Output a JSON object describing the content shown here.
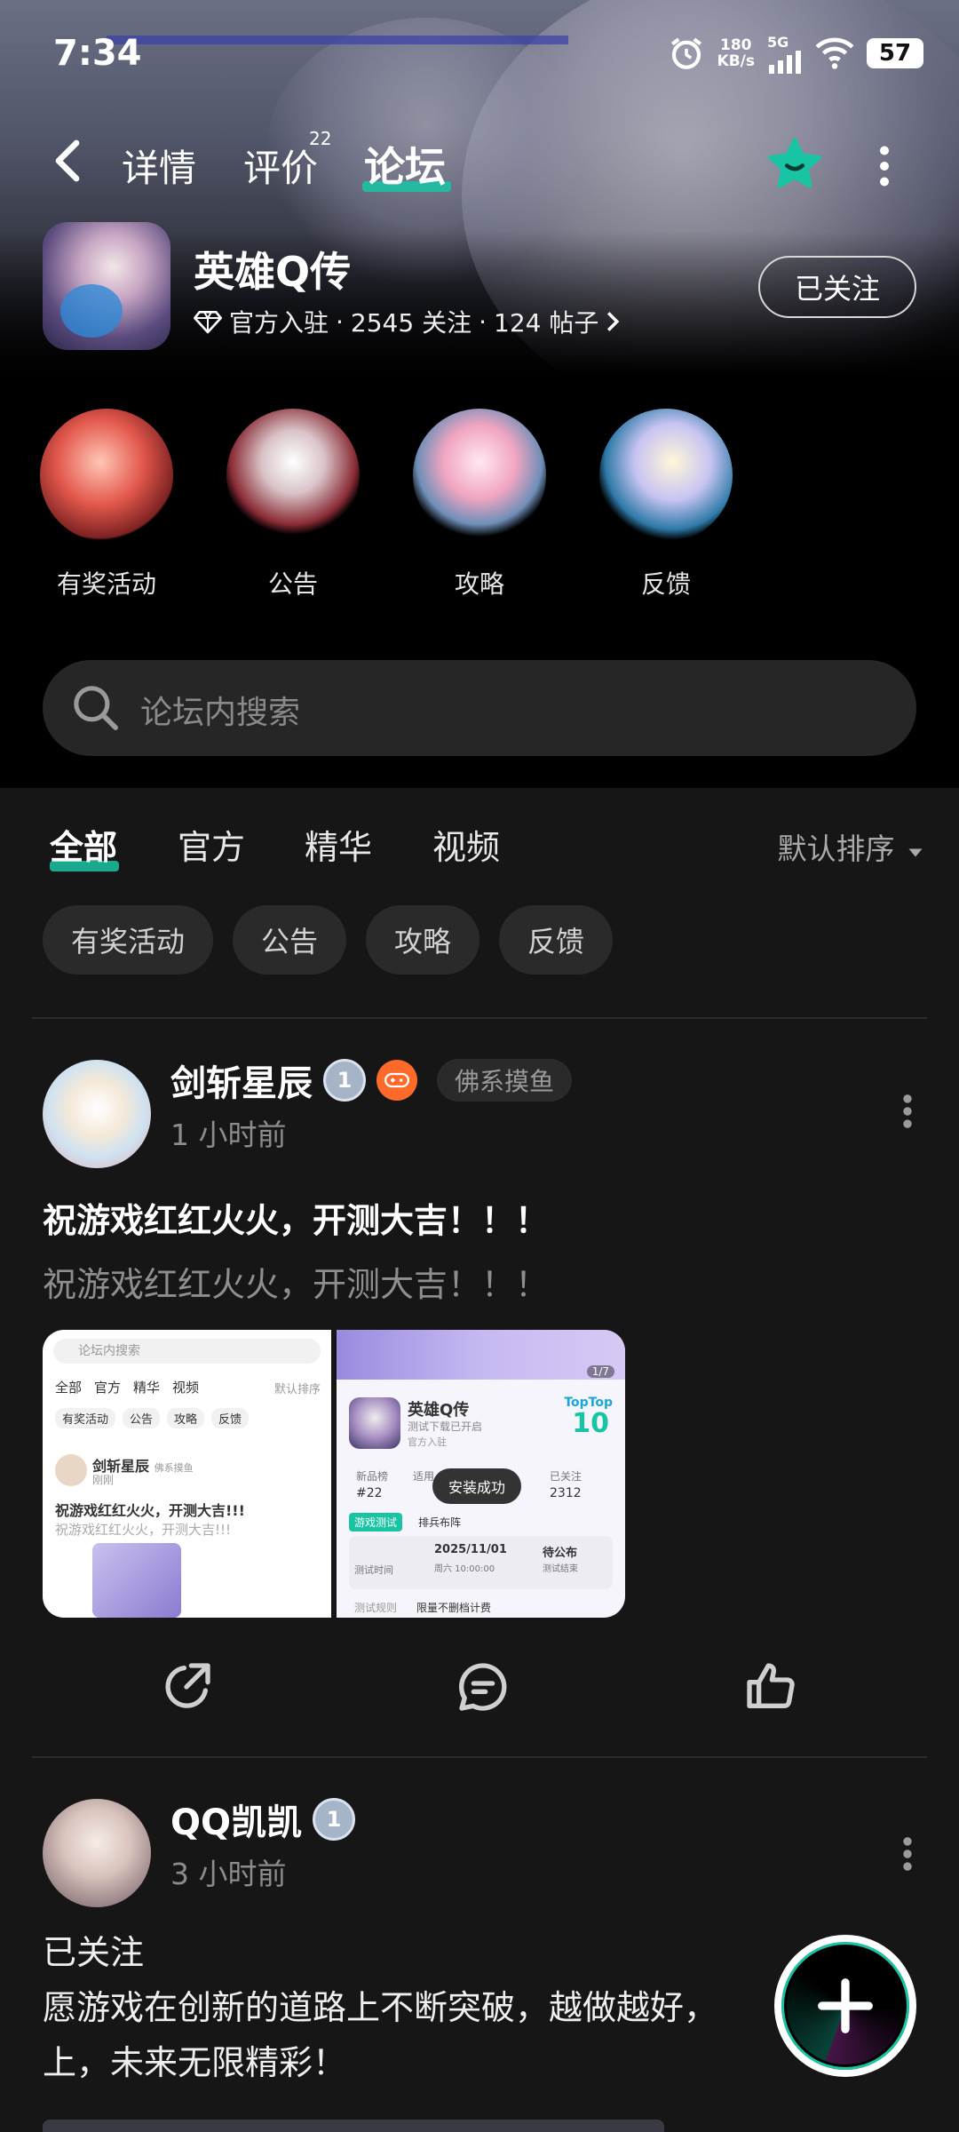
{
  "status_bar": {
    "time": "7:34",
    "speed_value": "180",
    "speed_unit": "KB/s",
    "network": "5G",
    "battery": "57"
  },
  "nav": {
    "tabs": [
      {
        "label": "详情"
      },
      {
        "label": "评价"
      },
      {
        "label": "论坛"
      }
    ],
    "review_count": "22",
    "active_tab": "论坛",
    "accent_color": "#19c4a4"
  },
  "app": {
    "name": "英雄Q传",
    "verified": "官方入驻",
    "followers": "2545 关注",
    "posts": "124 帖子",
    "follow_button": "已关注",
    "sep": "·"
  },
  "categories": [
    {
      "label": "有奖活动"
    },
    {
      "label": "公告"
    },
    {
      "label": "攻略"
    },
    {
      "label": "反馈"
    }
  ],
  "search": {
    "placeholder": "论坛内搜索"
  },
  "feed_tabs": {
    "items": [
      {
        "label": "全部"
      },
      {
        "label": "官方"
      },
      {
        "label": "精华"
      },
      {
        "label": "视频"
      }
    ],
    "sort_label": "默认排序"
  },
  "filter_chips": [
    {
      "label": "有奖活动"
    },
    {
      "label": "公告"
    },
    {
      "label": "攻略"
    },
    {
      "label": "反馈"
    }
  ],
  "posts": [
    {
      "author": "剑斩星辰",
      "level": "1",
      "tag": "佛系摸鱼",
      "time": "1 小时前",
      "title": "祝游戏红红火火，开测大吉！！！",
      "body": "祝游戏红红火火，开测大吉！！！",
      "images": [
        {
          "search": "论坛内搜索",
          "tabs": [
            "全部",
            "官方",
            "精华",
            "视频"
          ],
          "sort": "默认排序",
          "chips": [
            "有奖活动",
            "公告",
            "攻略",
            "反馈"
          ],
          "user": "剑斩星辰",
          "user_tag": "佛系摸鱼",
          "time": "刚刚",
          "title": "祝游戏红红火火，开测大吉!!!",
          "body": "祝游戏红红火火，开测大吉!!!"
        },
        {
          "counter": "1/7",
          "app_name": "英雄Q传",
          "subtitle": "测试下载已开启",
          "official": "官方入驻",
          "brand": "TopTop",
          "rank": "10",
          "stat1_label": "新品榜",
          "stat1_value": "#22",
          "stat2_label": "适用",
          "stat3_label": "已关注",
          "stat3_value": "2312",
          "toast": "安装成功",
          "test_tag": "游戏测试",
          "test_name": "排兵布阵",
          "date": "2025/11/01",
          "date_sub": "周六 10:00:00",
          "status": "待公布",
          "status_sub": "测试结束",
          "time_label": "测试时间",
          "rule_label": "测试规则",
          "rule_text": "限量不删档计费"
        }
      ]
    },
    {
      "author": "QQ凯凯",
      "level": "1",
      "time": "3 小时前",
      "title": "已关注",
      "body": "愿游戏在创新的道路上不断突破，越做越好，上，未来无限精彩！"
    }
  ]
}
